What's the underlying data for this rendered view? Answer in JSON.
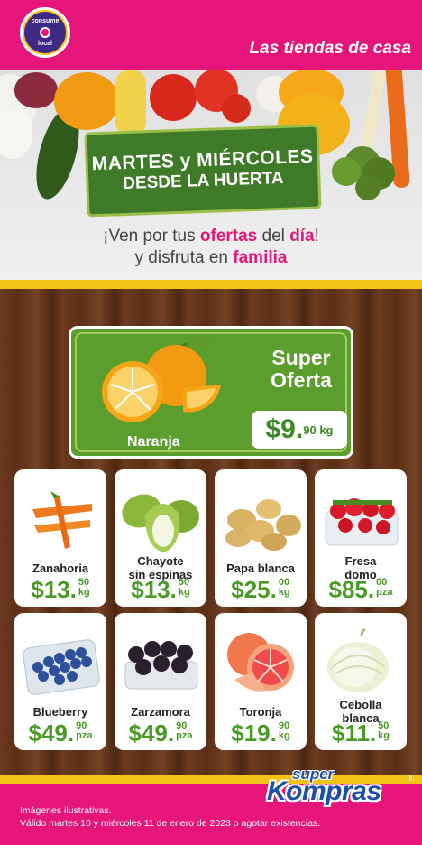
{
  "header": {
    "logo_line1": "consume",
    "logo_line2": "local",
    "tagline": "Las tiendas de casa"
  },
  "hero": {
    "banner_line1": "MARTES y MIÉRCOLES",
    "banner_line2": "DESDE LA HUERTA",
    "line1_a": "¡Ven por tus ",
    "line1_b": "ofertas",
    "line1_c": " del ",
    "line1_d": "día",
    "line1_e": "!",
    "line2_a": "y disfruta en ",
    "line2_b": "familia"
  },
  "super_offer": {
    "title_line1": "Super",
    "title_line2": "Oferta",
    "product": "Naranja",
    "price_main": "$9.",
    "price_cents": "90",
    "price_unit": "kg"
  },
  "products": [
    {
      "name_line1": "Zanahoria",
      "name_line2": "",
      "price_main": "$13.",
      "cents": "50",
      "unit": "kg"
    },
    {
      "name_line1": "Chayote",
      "name_line2": "sin espinas",
      "price_main": "$13.",
      "cents": "50",
      "unit": "kg"
    },
    {
      "name_line1": "Papa blanca",
      "name_line2": "",
      "price_main": "$25.",
      "cents": "00",
      "unit": "kg"
    },
    {
      "name_line1": "Fresa",
      "name_line2": "domo",
      "price_main": "$85.",
      "cents": "00",
      "unit": "pza"
    },
    {
      "name_line1": "Blueberry",
      "name_line2": "",
      "price_main": "$49.",
      "cents": "90",
      "unit": "pza"
    },
    {
      "name_line1": "Zarzamora",
      "name_line2": "",
      "price_main": "$49.",
      "cents": "90",
      "unit": "pza"
    },
    {
      "name_line1": "Toronja",
      "name_line2": "",
      "price_main": "$19.",
      "cents": "90",
      "unit": "kg"
    },
    {
      "name_line1": "Cebolla",
      "name_line2": "blanca",
      "price_main": "$11.",
      "cents": "50",
      "unit": "kg"
    }
  ],
  "brand": {
    "line1": "super",
    "line2": "Kompras",
    "reg": "®"
  },
  "footer": {
    "disclaimer1": "Imágenes ilustrativas.",
    "disclaimer2": "Válido martes 10 y miércoles 11 de enero de 2023 o agotar existencias."
  },
  "colors": {
    "magenta": "#e6157a",
    "yellow": "#f3c316",
    "green": "#4a9a26",
    "brand_blue": "#1b4fa8"
  }
}
